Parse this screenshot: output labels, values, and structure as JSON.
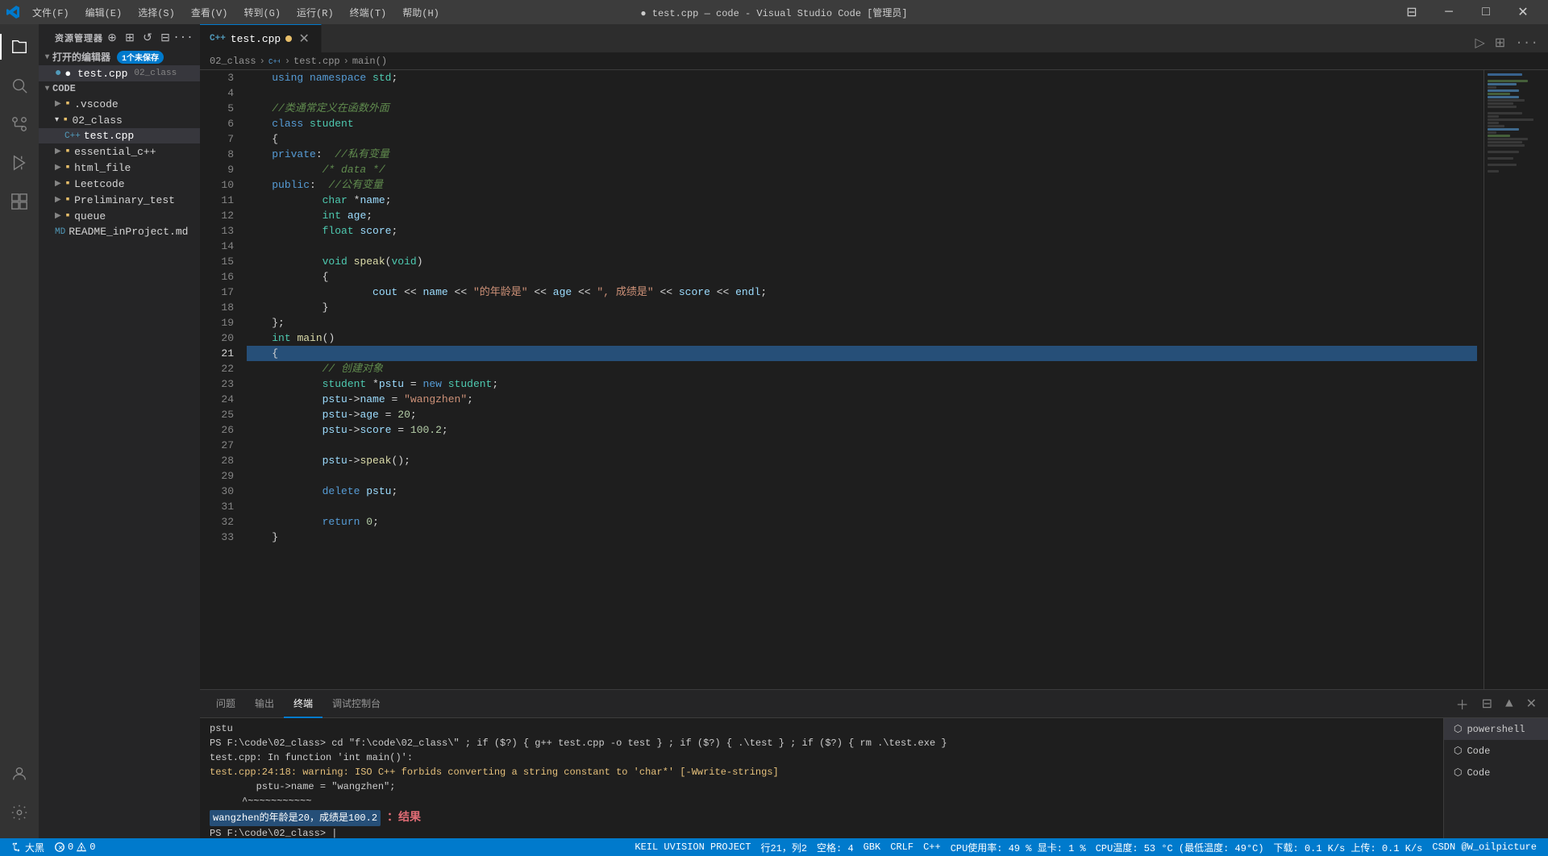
{
  "titlebar": {
    "title": "● test.cpp — code - Visual Studio Code [管理员]",
    "menu_items": [
      "文件(F)",
      "编辑(E)",
      "选择(S)",
      "查看(V)",
      "转到(G)",
      "运行(R)",
      "终端(T)",
      "帮助(H)"
    ]
  },
  "activitybar": {
    "icons": [
      "explorer",
      "search",
      "source-control",
      "run-debug",
      "extensions",
      "account",
      "settings"
    ]
  },
  "sidebar": {
    "title": "资源管理器",
    "open_editors": {
      "label": "打开的编辑器",
      "badge": "1个未保存",
      "files": [
        {
          "name": "● test.cpp",
          "path": "02_class"
        }
      ]
    },
    "workspace": "CODE",
    "tree": [
      {
        "name": ".vscode",
        "type": "folder",
        "indent": 1
      },
      {
        "name": "02_class",
        "type": "folder",
        "indent": 1,
        "expanded": true
      },
      {
        "name": "test.cpp",
        "type": "file-cpp",
        "indent": 2,
        "active": true
      },
      {
        "name": "essential_c++",
        "type": "folder",
        "indent": 1
      },
      {
        "name": "html_file",
        "type": "folder",
        "indent": 1
      },
      {
        "name": "Leetcode",
        "type": "folder",
        "indent": 1
      },
      {
        "name": "Preliminary_test",
        "type": "folder",
        "indent": 1
      },
      {
        "name": "queue",
        "type": "folder",
        "indent": 1
      },
      {
        "name": "README_inProject.md",
        "type": "file-md",
        "indent": 1
      }
    ]
  },
  "editor": {
    "tab": {
      "name": "test.cpp",
      "modified": true
    },
    "breadcrumb": [
      "02_class",
      "C++",
      "test.cpp",
      "main()"
    ],
    "lines": [
      {
        "num": 3,
        "code": "    using namespace std;"
      },
      {
        "num": 4,
        "code": ""
      },
      {
        "num": 5,
        "code": "    //类通常定义在函数外面"
      },
      {
        "num": 6,
        "code": "    class student"
      },
      {
        "num": 7,
        "code": "    {"
      },
      {
        "num": 8,
        "code": "    private:  //私有变量"
      },
      {
        "num": 9,
        "code": "            /* data */"
      },
      {
        "num": 10,
        "code": "    public:  //公有变量"
      },
      {
        "num": 11,
        "code": "            char *name;"
      },
      {
        "num": 12,
        "code": "            int age;"
      },
      {
        "num": 13,
        "code": "            float score;"
      },
      {
        "num": 14,
        "code": ""
      },
      {
        "num": 15,
        "code": "            void speak(void)"
      },
      {
        "num": 16,
        "code": "            {"
      },
      {
        "num": 17,
        "code": "                    cout << name << \"的年龄是\" << age << \", 成绩是\" << score << endl;"
      },
      {
        "num": 18,
        "code": "            }"
      },
      {
        "num": 19,
        "code": "    };"
      },
      {
        "num": 20,
        "code": "    int main()"
      },
      {
        "num": 21,
        "code": "    {",
        "highlighted": true
      },
      {
        "num": 22,
        "code": "            // 创建对象"
      },
      {
        "num": 23,
        "code": "            student *pstu = new student;"
      },
      {
        "num": 24,
        "code": "            pstu->name = \"wangzhen\";"
      },
      {
        "num": 25,
        "code": "            pstu->age = 20;"
      },
      {
        "num": 26,
        "code": "            pstu->score = 100.2;"
      },
      {
        "num": 27,
        "code": ""
      },
      {
        "num": 28,
        "code": "            pstu->speak();"
      },
      {
        "num": 29,
        "code": ""
      },
      {
        "num": 30,
        "code": "            delete pstu;"
      },
      {
        "num": 31,
        "code": ""
      },
      {
        "num": 32,
        "code": "            return 0;"
      },
      {
        "num": 33,
        "code": "    }"
      }
    ]
  },
  "panel": {
    "tabs": [
      "问题",
      "输出",
      "终端",
      "调试控制台"
    ],
    "active_tab": "终端",
    "terminal_lines": [
      "pstu",
      "PS F:\\code\\02_class> cd \"f:\\code\\02_class\\\" ; if ($?) { g++ test.cpp -o test } ; if ($?) { .\\test } ; if ($?) { rm .\\test.exe }",
      "test.cpp: In function 'int main()':",
      "test.cpp:24:18: warning: ISO C++ forbids converting a string constant to 'char*' [-Wwrite-strings]",
      "        pstu->name = \"wangzhen\";"
    ],
    "result_text": "wangzhen的年龄是20，成绩是100.2",
    "result_label": "：结果",
    "prompt_line": "PS F:\\code\\02_class> |"
  },
  "right_terminal_list": {
    "items": [
      "powershell",
      "Code",
      "Code"
    ]
  },
  "statusbar": {
    "left": [
      {
        "icon": "git-branch",
        "text": "大黑"
      },
      {
        "icon": "warning",
        "text": "0"
      },
      {
        "icon": "error",
        "text": "0"
      }
    ],
    "project": "KEIL UVISION PROJECT",
    "right": [
      {
        "text": "行21，列2"
      },
      {
        "text": "空格: 4"
      },
      {
        "text": "GBK"
      },
      {
        "text": "CRLF"
      },
      {
        "text": "C++"
      },
      {
        "text": "CPU使用率: 49 %  显卡: 1 %"
      },
      {
        "text": "CPU温度: 53 °C (最低温度: 49°C)"
      },
      {
        "text": "下载: 0.1 K/s  上传: 0.1 K/s"
      },
      {
        "text": "CSDN @W_oilpicture"
      }
    ]
  }
}
